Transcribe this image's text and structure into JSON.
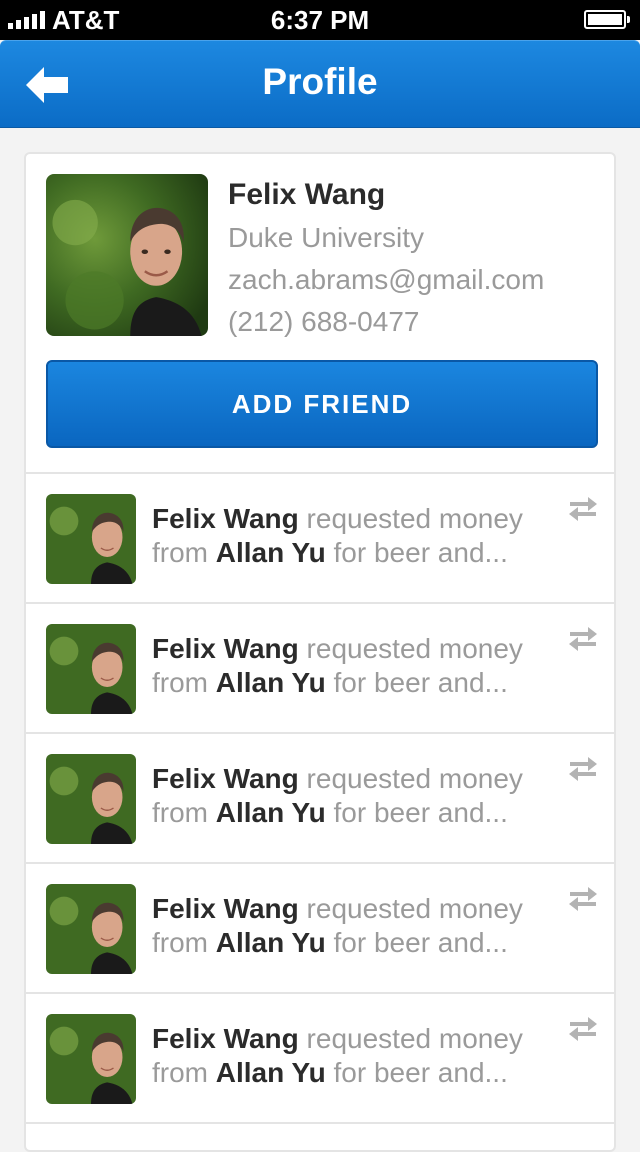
{
  "status_bar": {
    "carrier": "AT&T",
    "time": "6:37 PM"
  },
  "nav": {
    "title": "Profile",
    "back_icon": "arrow-left-icon"
  },
  "profile": {
    "name": "Felix Wang",
    "school": "Duke University",
    "email": "zach.abrams@gmail.com",
    "phone": "(212) 688-0477",
    "add_friend_label": "ADD FRIEND"
  },
  "feed": [
    {
      "actor": "Felix Wang",
      "action": "requested money",
      "from_word": "from",
      "target": "Allan Yu",
      "note": "for beer and...",
      "icon": "swap-arrows-icon"
    },
    {
      "actor": "Felix Wang",
      "action": "requested money",
      "from_word": "from",
      "target": "Allan Yu",
      "note": "for beer and...",
      "icon": "swap-arrows-icon"
    },
    {
      "actor": "Felix Wang",
      "action": "requested money",
      "from_word": "from",
      "target": "Allan Yu",
      "note": "for beer and...",
      "icon": "swap-arrows-icon"
    },
    {
      "actor": "Felix Wang",
      "action": "requested money",
      "from_word": "from",
      "target": "Allan Yu",
      "note": "for beer and...",
      "icon": "swap-arrows-icon"
    },
    {
      "actor": "Felix Wang",
      "action": "requested money",
      "from_word": "from",
      "target": "Allan Yu",
      "note": "for beer and...",
      "icon": "swap-arrows-icon"
    }
  ],
  "colors": {
    "brand_blue": "#0b6cc6",
    "text_dark": "#2b2b2b",
    "text_muted": "#9a9a9a"
  }
}
